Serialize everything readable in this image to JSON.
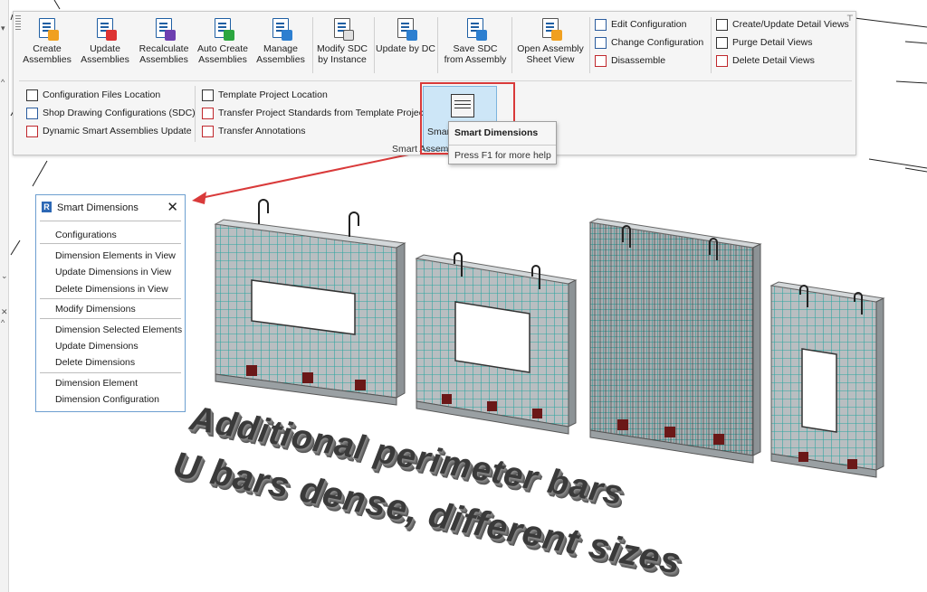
{
  "ribbon": {
    "big_buttons": [
      {
        "label": "Create\nAssemblies"
      },
      {
        "label": "Update\nAssemblies"
      },
      {
        "label": "Recalculate\nAssemblies"
      },
      {
        "label": "Auto Create\nAssemblies"
      },
      {
        "label": "Manage\nAssemblies"
      },
      {
        "label": "Modify SDC\nby Instance"
      },
      {
        "label": "Update by DC"
      },
      {
        "label": "Save SDC\nfrom Assembly"
      },
      {
        "label": "Open Assembly\nSheet View"
      }
    ],
    "config_col": [
      "Edit Configuration",
      "Change Configuration",
      "Disassemble"
    ],
    "detail_col": [
      "Create/Update Detail Views",
      "Purge Detail Views",
      "Delete Detail Views"
    ],
    "lower_left": [
      "Configuration Files Location",
      "Shop Drawing Configurations (SDC)",
      "Dynamic Smart Assemblies Update"
    ],
    "lower_mid": [
      "Template Project Location",
      "Transfer Project Standards from Template Project",
      "Transfer Annotations"
    ],
    "smart_dimensions_button": "Smart Dimensions",
    "panel_title": "Smart Assemblies"
  },
  "tooltip": {
    "title": "Smart Dimensions",
    "help": "Press F1 for more help"
  },
  "palette": {
    "title": "Smart Dimensions",
    "groups": [
      [
        "Configurations"
      ],
      [
        "Dimension Elements in View",
        "Update Dimensions in View",
        "Delete Dimensions in View"
      ],
      [
        "Modify Dimensions"
      ],
      [
        "Dimension Selected Elements",
        "Update Dimensions",
        "Delete Dimensions"
      ],
      [
        "Dimension Element",
        "Dimension Configuration"
      ]
    ]
  },
  "annotation": {
    "line1": "Additional perimeter bars",
    "line2": "U bars dense, different sizes"
  },
  "colors": {
    "accent_red": "#d93a3a",
    "rebar_teal": "#2aa6a0",
    "concrete": "#bfc4c6",
    "highlight": "#cde6f7"
  }
}
